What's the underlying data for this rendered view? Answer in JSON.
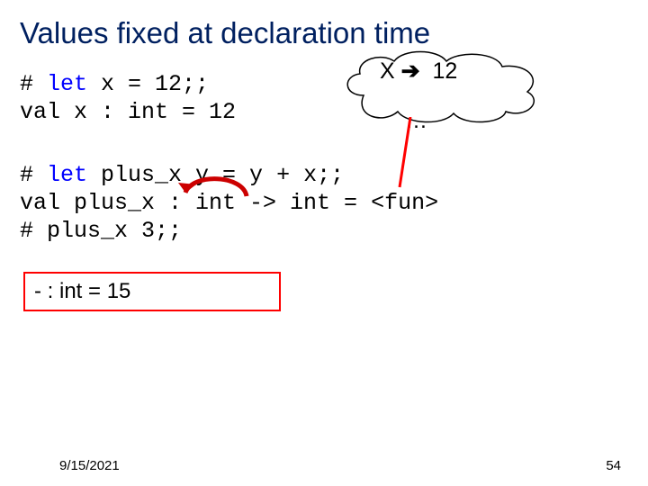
{
  "title": "Values fixed at declaration time",
  "code_block1": {
    "line1_prefix": "# ",
    "line1_kw": "let",
    "line1_rest": " x = 12;;",
    "line2": "val x : int = 12"
  },
  "cloud": {
    "line1_x": "X ",
    "line1_arrow": "➔",
    "line1_val": "  12",
    "line2": "…"
  },
  "code_block2": {
    "line1_prefix": "# ",
    "line1_kw": "let",
    "line1_rest": " plus_x y = y + x;;",
    "line2": "val plus_x : int -> int = <fun>",
    "line3": "# plus_x 3;;"
  },
  "result": "- : int = 15",
  "footer": {
    "date": "9/15/2021",
    "page": "54"
  }
}
